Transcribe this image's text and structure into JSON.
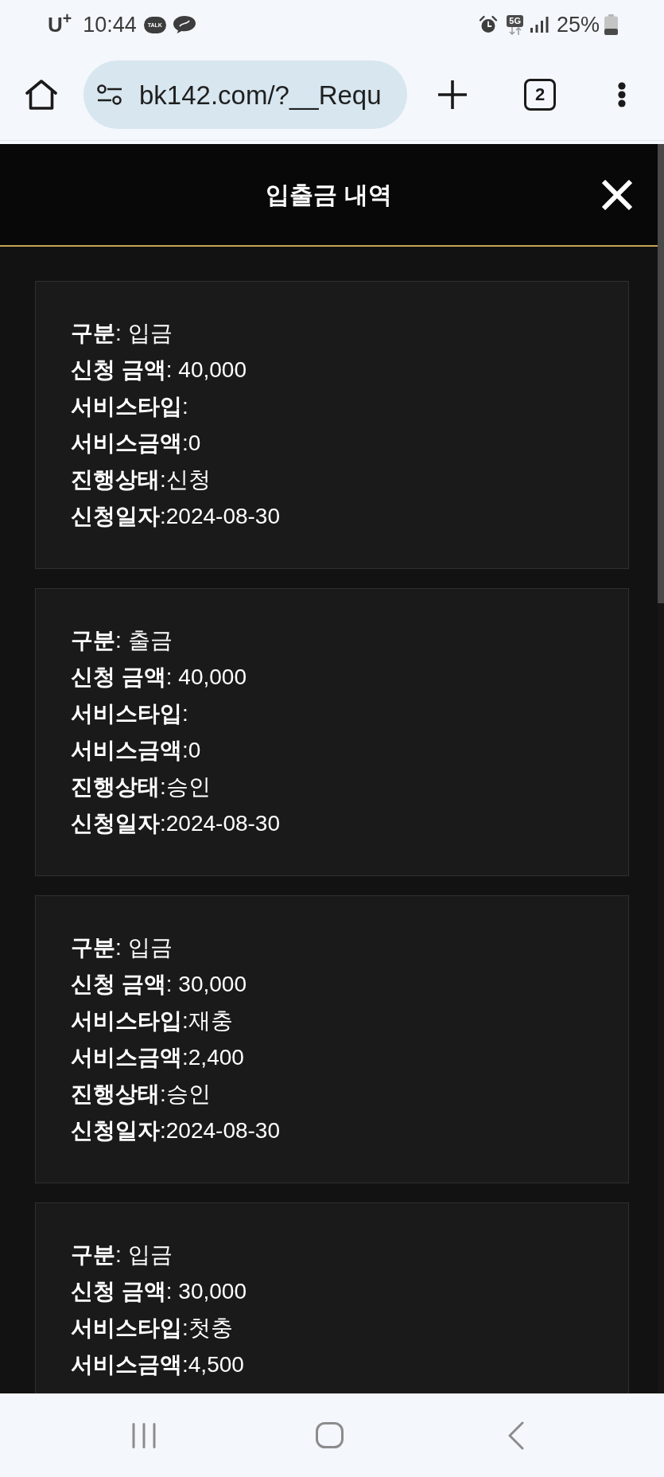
{
  "status_bar": {
    "carrier": "U$^{+}$",
    "time": "10:44",
    "talk_badge": "TALK",
    "network_badge": "5G",
    "battery": "25%"
  },
  "browser": {
    "url": "bk142.com/?__Requ",
    "tab_count": "2"
  },
  "modal": {
    "title": "입출금 내역",
    "records": [
      {
        "fields": [
          "**구분**: 입금",
          "**신청 금액**: 40,000",
          "**서비스타입**:",
          "**서비스금액**:0",
          "**진행상태**:신청",
          "**신청일자**:2024-08-30"
        ]
      },
      {
        "fields": [
          "**구분**: 출금",
          "**신청 금액**: 40,000",
          "**서비스타입**:",
          "**서비스금액**:0",
          "**진행상태**:승인",
          "**신청일자**:2024-08-30"
        ]
      },
      {
        "fields": [
          "**구분**: 입금",
          "**신청 금액**: 30,000",
          "**서비스타입**:재충",
          "**서비스금액**:2,400",
          "**진행상태**:승인",
          "**신청일자**:2024-08-30"
        ]
      },
      {
        "fields": [
          "**구분**: 입금",
          "**신청 금액**: 30,000",
          "**서비스타입**:첫충",
          "**서비스금액**:4,500"
        ]
      }
    ]
  }
}
